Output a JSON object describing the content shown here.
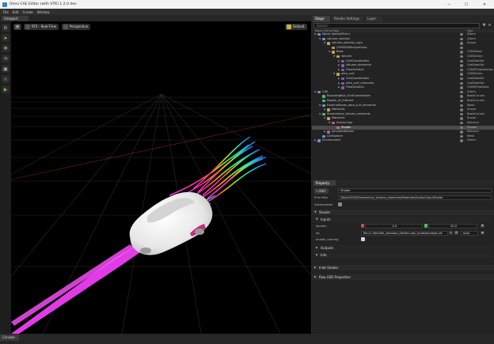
{
  "window": {
    "title": "Omni CAE Editor (with VTK) 1.2.0 dev",
    "min_glyph": "─",
    "max_glyph": "☐",
    "close_glyph": "✕"
  },
  "menu": [
    "File",
    "Edit",
    "Create",
    "Window"
  ],
  "viewport": {
    "tab_label": "Viewport",
    "renderer_label": "RTX - Real-Time",
    "camera_label": "Perspective",
    "light_label": "Default"
  },
  "tools": {
    "settings_glyph": "⚙",
    "select_glyph": "➤",
    "move_glyph": "✥",
    "rotate_glyph": "⟲",
    "scale_glyph": "▣",
    "snap_glyph": "∩",
    "play_glyph": "▶"
  },
  "bottom": {
    "console_label": "Console"
  },
  "stage": {
    "tabs": [
      "Stage",
      "Render Settings",
      "Layer"
    ],
    "search_placeholder": "Search",
    "columns": {
      "name": "Name (Old to New)",
      "type": "Type"
    },
    "rows": [
      {
        "label": "World (defaultPrim)",
        "type": "Xform",
        "level": 0,
        "exp": "▼",
        "icon": "xform"
      },
      {
        "label": "volume_solution",
        "type": "Xform",
        "level": 1,
        "exp": "▼",
        "icon": "xform"
      },
      {
        "label": "volume_solution_vgrs",
        "type": "Scope",
        "level": 2,
        "exp": "▼",
        "icon": "folder"
      },
      {
        "label": "CGNSFileMerrgeClass",
        "type": "",
        "level": 3,
        "exp": "",
        "icon": "file"
      },
      {
        "label": "Base",
        "type": "CGNSBase",
        "level": 3,
        "exp": "▼",
        "icon": "folder"
      },
      {
        "label": "Volume",
        "type": "CGNSZone",
        "level": 4,
        "exp": "▼",
        "icon": "folder"
      },
      {
        "label": "GridCoordinates",
        "type": "CaeDataSet",
        "level": 5,
        "exp": "▶",
        "icon": "grid"
      },
      {
        "label": "Volume_elements",
        "type": "CaeDataSet",
        "level": 5,
        "exp": "▶",
        "icon": "grid"
      },
      {
        "label": "FlowSolution",
        "type": "CGNSFlowSolution",
        "level": 5,
        "exp": "▶",
        "icon": "grid"
      },
      {
        "label": "aero_surf",
        "type": "CGNSZone",
        "level": 4,
        "exp": "▼",
        "icon": "folder"
      },
      {
        "label": "GridCoordinates",
        "type": "CaeDataSet",
        "level": 5,
        "exp": "▶",
        "icon": "grid"
      },
      {
        "label": "aero_surf_elements",
        "type": "CaeDataSet",
        "level": 5,
        "exp": "▶",
        "icon": "grid"
      },
      {
        "label": "FlowSolution",
        "type": "CGNSFlowSolut",
        "level": 5,
        "exp": "▶",
        "icon": "grid"
      },
      {
        "label": "CAE",
        "type": "Xform",
        "level": 0,
        "exp": "▼",
        "icon": "xform"
      },
      {
        "label": "BoundingBox_GridCoordinates",
        "type": "BasisCurves",
        "level": 1,
        "exp": "",
        "icon": "curve"
      },
      {
        "label": "Region_of_Interest",
        "type": "BasisCurves",
        "level": 1,
        "exp": "",
        "icon": "curve"
      },
      {
        "label": "ExternalFaces_aero_surf_elements",
        "type": "Mesh",
        "level": 1,
        "exp": "▼",
        "icon": "mesh"
      },
      {
        "label": "Materials",
        "type": "Scope",
        "level": 2,
        "exp": "▶",
        "icon": "folder"
      },
      {
        "label": "Streamlines_Volume_elements",
        "type": "BasisCurves",
        "level": 1,
        "exp": "▼",
        "icon": "curve"
      },
      {
        "label": "Materials",
        "type": "Scope",
        "level": 2,
        "exp": "▼",
        "icon": "folder"
      },
      {
        "label": "ScalarColor",
        "type": "Material",
        "level": 3,
        "exp": "▼",
        "icon": "material"
      },
      {
        "label": "Shader",
        "type": "Shader",
        "level": 4,
        "exp": "",
        "icon": "shader",
        "selected": true
      },
      {
        "label": "ActivatedSeeds",
        "type": "Material",
        "level": 2,
        "exp": "▶",
        "icon": "material"
      },
      {
        "label": "UnitSphere",
        "type": "Mesh",
        "level": 1,
        "exp": "",
        "icon": "mesh"
      },
      {
        "label": "Environment",
        "type": "Xform",
        "level": 0,
        "exp": "▶",
        "icon": "xform"
      }
    ]
  },
  "property": {
    "tab_label": "Property",
    "add_label": "Add",
    "name_value": "Shader",
    "prim_path_label": "Prim Path",
    "prim_path_value": "/World/CAE/Streamlines_Volume_elements/Materials/ScalarColor/Shader",
    "instanceable_label": "Instanceable",
    "sections": {
      "shader": "Shader",
      "inputs": "Inputs",
      "outputs": "Outputs",
      "info": "Info",
      "inlet_shader": "Inlet Shader",
      "raw_usd": "Raw USD Properties"
    },
    "domain_label": "domain",
    "domain_min": "0.0",
    "domain_max": "25.0",
    "x_chip": "X",
    "y_chip": "Y",
    "lut_label": "lut",
    "lut_value": "file:/C:/dev/tile_windows_file/ide-cae/_build/windows-x8",
    "lut_mode": "auto",
    "enable_coloring_label": "enable_coloring"
  }
}
